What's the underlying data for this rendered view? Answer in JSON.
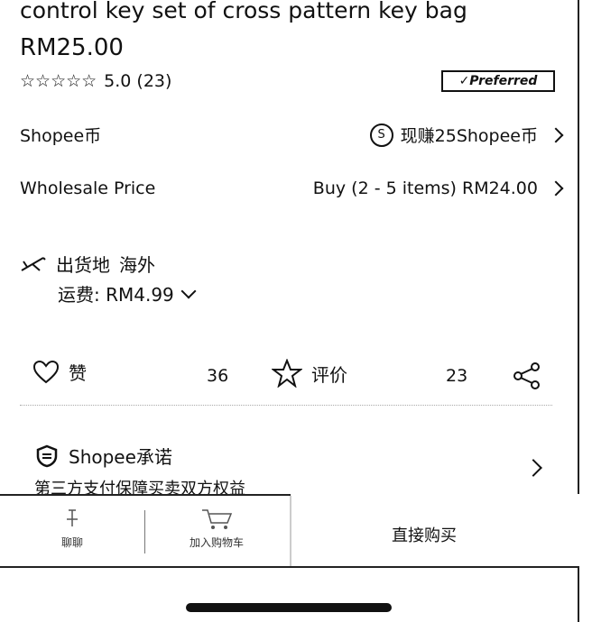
{
  "product": {
    "title": "control key set of cross pattern key bag",
    "price": "RM25.00",
    "stars": "☆☆☆☆☆",
    "rating_text": "5.0 (23)",
    "badge": "✓Preferred"
  },
  "coins": {
    "label": "Shopee币",
    "value": "现赚25Shopee币",
    "coin_glyph": "S"
  },
  "wholesale": {
    "label": "Wholesale Price",
    "value": "Buy (2 - 5 items) RM24.00"
  },
  "shipping": {
    "from_label": "出货地",
    "from_value": "海外",
    "fee": "运费: RM4.99"
  },
  "actions": {
    "like_label": "赞",
    "like_count": "36",
    "rate_label": "评价",
    "rate_count": "23"
  },
  "promise": {
    "title": "Shopee承诺",
    "subtitle": "第三方支付保障买卖双方权益"
  },
  "bottom": {
    "chat_label": "聊聊",
    "cart_label": "加入购物车",
    "buy_label": "直接购买"
  }
}
